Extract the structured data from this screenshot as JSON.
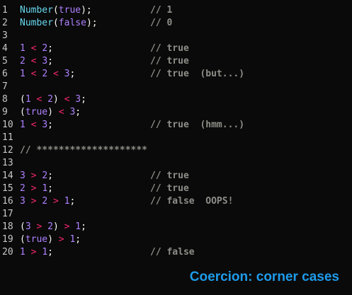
{
  "editor": {
    "lines": [
      {
        "n": "1",
        "code": [
          [
            "fn",
            "Number"
          ],
          [
            "p",
            "("
          ],
          [
            "kw",
            "true"
          ],
          [
            "p",
            ");"
          ]
        ],
        "comment": "// 1"
      },
      {
        "n": "2",
        "code": [
          [
            "fn",
            "Number"
          ],
          [
            "p",
            "("
          ],
          [
            "kw",
            "false"
          ],
          [
            "p",
            ");"
          ]
        ],
        "comment": "// 0"
      },
      {
        "n": "3",
        "code": [],
        "comment": ""
      },
      {
        "n": "4",
        "code": [
          [
            "num",
            "1"
          ],
          [
            "p",
            " "
          ],
          [
            "op",
            "<"
          ],
          [
            "p",
            " "
          ],
          [
            "num",
            "2"
          ],
          [
            "p",
            ";"
          ]
        ],
        "comment": "// true"
      },
      {
        "n": "5",
        "code": [
          [
            "num",
            "2"
          ],
          [
            "p",
            " "
          ],
          [
            "op",
            "<"
          ],
          [
            "p",
            " "
          ],
          [
            "num",
            "3"
          ],
          [
            "p",
            ";"
          ]
        ],
        "comment": "// true"
      },
      {
        "n": "6",
        "code": [
          [
            "num",
            "1"
          ],
          [
            "p",
            " "
          ],
          [
            "op",
            "<"
          ],
          [
            "p",
            " "
          ],
          [
            "num",
            "2"
          ],
          [
            "p",
            " "
          ],
          [
            "op",
            "<"
          ],
          [
            "p",
            " "
          ],
          [
            "num",
            "3"
          ],
          [
            "p",
            ";"
          ]
        ],
        "comment": "// true  (but...)"
      },
      {
        "n": "7",
        "code": [],
        "comment": ""
      },
      {
        "n": "8",
        "code": [
          [
            "p",
            "("
          ],
          [
            "num",
            "1"
          ],
          [
            "p",
            " "
          ],
          [
            "op",
            "<"
          ],
          [
            "p",
            " "
          ],
          [
            "num",
            "2"
          ],
          [
            "p",
            ") "
          ],
          [
            "op",
            "<"
          ],
          [
            "p",
            " "
          ],
          [
            "num",
            "3"
          ],
          [
            "p",
            ";"
          ]
        ],
        "comment": ""
      },
      {
        "n": "9",
        "code": [
          [
            "p",
            "("
          ],
          [
            "kw",
            "true"
          ],
          [
            "p",
            ") "
          ],
          [
            "op",
            "<"
          ],
          [
            "p",
            " "
          ],
          [
            "num",
            "3"
          ],
          [
            "p",
            ";"
          ]
        ],
        "comment": ""
      },
      {
        "n": "10",
        "code": [
          [
            "num",
            "1"
          ],
          [
            "p",
            " "
          ],
          [
            "op",
            "<"
          ],
          [
            "p",
            " "
          ],
          [
            "num",
            "3"
          ],
          [
            "p",
            ";"
          ]
        ],
        "comment": "// true  (hmm...)"
      },
      {
        "n": "11",
        "code": [],
        "comment": ""
      },
      {
        "n": "12",
        "code": [
          [
            "sep",
            "// ********************"
          ]
        ],
        "comment": ""
      },
      {
        "n": "13",
        "code": [],
        "comment": ""
      },
      {
        "n": "14",
        "code": [
          [
            "num",
            "3"
          ],
          [
            "p",
            " "
          ],
          [
            "op",
            ">"
          ],
          [
            "p",
            " "
          ],
          [
            "num",
            "2"
          ],
          [
            "p",
            ";"
          ]
        ],
        "comment": "// true"
      },
      {
        "n": "15",
        "code": [
          [
            "num",
            "2"
          ],
          [
            "p",
            " "
          ],
          [
            "op",
            ">"
          ],
          [
            "p",
            " "
          ],
          [
            "num",
            "1"
          ],
          [
            "p",
            ";"
          ]
        ],
        "comment": "// true"
      },
      {
        "n": "16",
        "code": [
          [
            "num",
            "3"
          ],
          [
            "p",
            " "
          ],
          [
            "op",
            ">"
          ],
          [
            "p",
            " "
          ],
          [
            "num",
            "2"
          ],
          [
            "p",
            " "
          ],
          [
            "op",
            ">"
          ],
          [
            "p",
            " "
          ],
          [
            "num",
            "1"
          ],
          [
            "p",
            ";"
          ]
        ],
        "comment": "// false  OOPS!"
      },
      {
        "n": "17",
        "code": [],
        "comment": ""
      },
      {
        "n": "18",
        "code": [
          [
            "p",
            "("
          ],
          [
            "num",
            "3"
          ],
          [
            "p",
            " "
          ],
          [
            "op",
            ">"
          ],
          [
            "p",
            " "
          ],
          [
            "num",
            "2"
          ],
          [
            "p",
            ") "
          ],
          [
            "op",
            ">"
          ],
          [
            "p",
            " "
          ],
          [
            "num",
            "1"
          ],
          [
            "p",
            ";"
          ]
        ],
        "comment": ""
      },
      {
        "n": "19",
        "code": [
          [
            "p",
            "("
          ],
          [
            "kw",
            "true"
          ],
          [
            "p",
            ") "
          ],
          [
            "op",
            ">"
          ],
          [
            "p",
            " "
          ],
          [
            "num",
            "1"
          ],
          [
            "p",
            ";"
          ]
        ],
        "comment": ""
      },
      {
        "n": "20",
        "code": [
          [
            "num",
            "1"
          ],
          [
            "p",
            " "
          ],
          [
            "op",
            ">"
          ],
          [
            "p",
            " "
          ],
          [
            "num",
            "1"
          ],
          [
            "p",
            ";"
          ]
        ],
        "comment": "// false"
      }
    ]
  },
  "caption": "Coercion: corner cases",
  "colors": {
    "background": "#0a0a0a",
    "function": "#67d8ef",
    "keyword_number": "#ae81ff",
    "operator": "#f92672",
    "comment": "#8e8e88",
    "caption": "#1e9bea"
  }
}
